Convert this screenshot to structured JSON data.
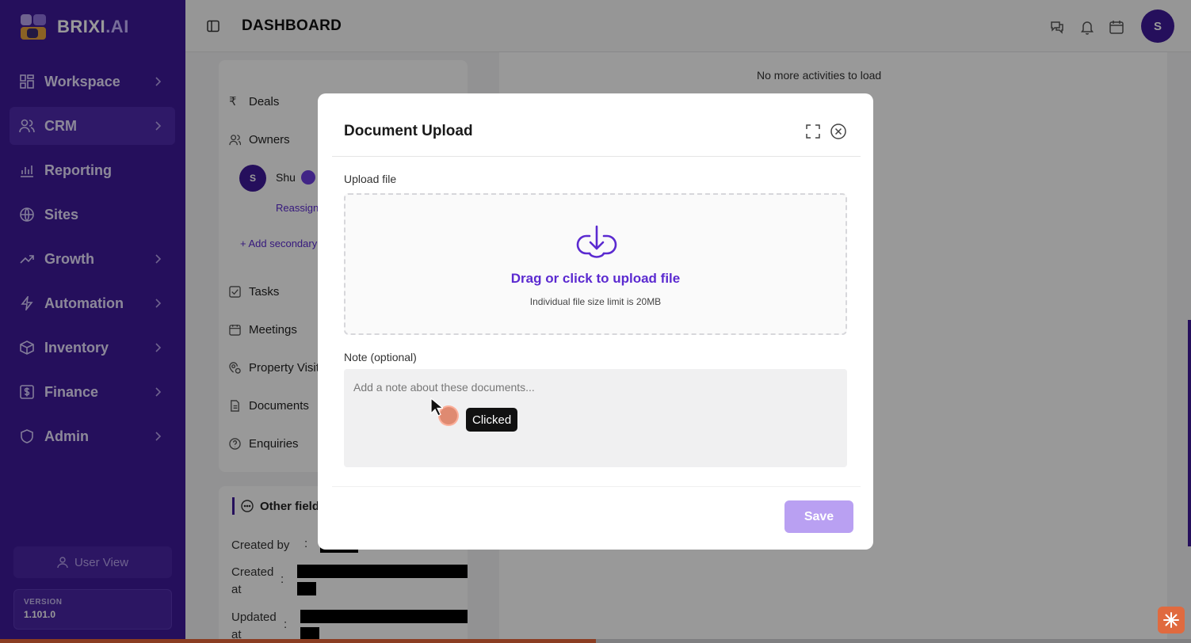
{
  "app": {
    "logo_text": "BRIXI",
    "logo_suffix": ".AI",
    "page_title": "DASHBOARD",
    "avatar_initial": "S"
  },
  "sidebar": {
    "items": [
      {
        "label": "Workspace",
        "icon": "grid-icon",
        "has_chevron": true
      },
      {
        "label": "CRM",
        "icon": "users-icon",
        "has_chevron": true,
        "active": true
      },
      {
        "label": "Reporting",
        "icon": "chart-icon",
        "has_chevron": false
      },
      {
        "label": "Sites",
        "icon": "globe-icon",
        "has_chevron": false
      },
      {
        "label": "Growth",
        "icon": "trend-icon",
        "has_chevron": true
      },
      {
        "label": "Automation",
        "icon": "bolt-icon",
        "has_chevron": true
      },
      {
        "label": "Inventory",
        "icon": "box-icon",
        "has_chevron": true
      },
      {
        "label": "Finance",
        "icon": "dollar-icon",
        "has_chevron": true
      },
      {
        "label": "Admin",
        "icon": "shield-icon",
        "has_chevron": true
      }
    ],
    "user_view": "User View",
    "version_label": "VERSION",
    "version_value": "1.101.0"
  },
  "background": {
    "left_items": {
      "deals": "Deals",
      "owners": "Owners",
      "owner_initial": "S",
      "owner_name": "Shu",
      "reassign": "Reassign",
      "add_secondary": "+ Add secondary",
      "tasks": "Tasks",
      "meetings": "Meetings",
      "property_visits": "Property Visit",
      "documents": "Documents",
      "enquiries": "Enquiries"
    },
    "other_fields": {
      "title": "Other field",
      "created_by": "Created by",
      "created_at_1": "Created",
      "created_at_2": "at",
      "updated_at_1": "Updated",
      "updated_at_2": "at",
      "colon": ":"
    },
    "activity_text": "No more activities to load"
  },
  "modal": {
    "title": "Document Upload",
    "upload_label": "Upload file",
    "dropzone_title": "Drag or click to upload file",
    "dropzone_subtitle": "Individual file size limit is 20MB",
    "note_label": "Note (optional)",
    "note_placeholder": "Add a note about these documents...",
    "note_value": "",
    "save_label": "Save"
  },
  "overlay": {
    "tooltip": "Clicked"
  },
  "progress": {
    "fraction": 0.5
  },
  "colors": {
    "sidebar_bg": "#3f1a99",
    "accent": "#5b2ad0",
    "save_disabled": "#b9a0f2"
  }
}
